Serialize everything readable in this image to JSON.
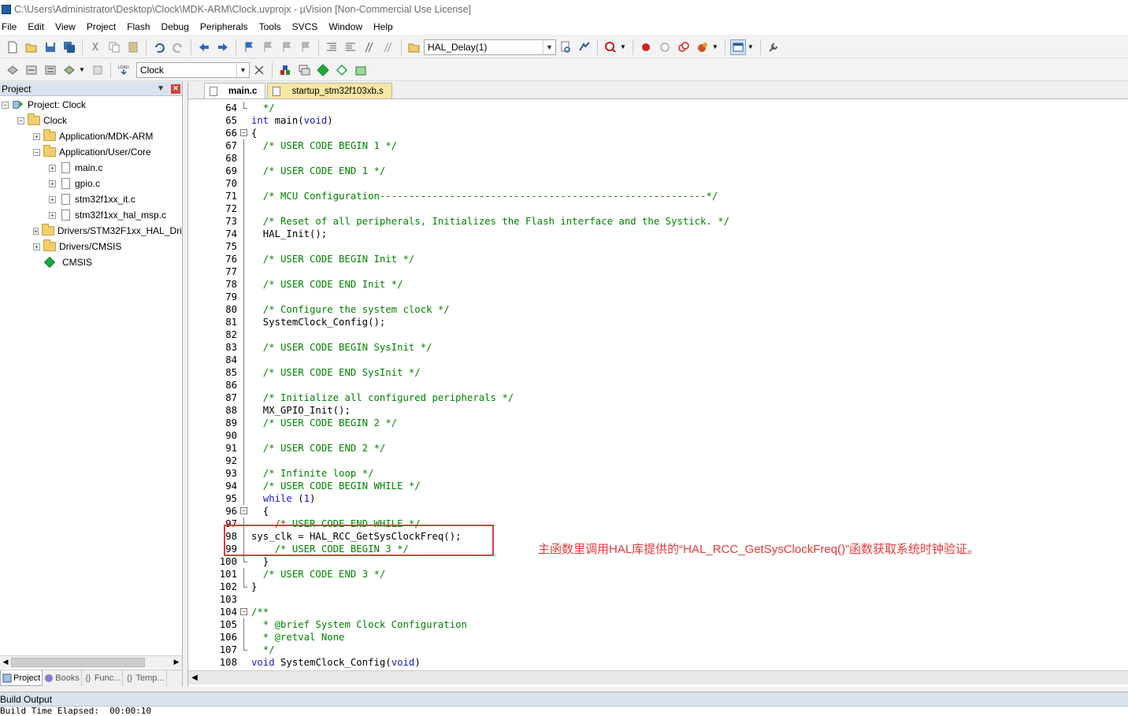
{
  "window": {
    "title": "C:\\Users\\Administrator\\Desktop\\Clock\\MDK-ARM\\Clock.uvprojx - µVision  [Non-Commercial Use License]"
  },
  "menu": [
    "File",
    "Edit",
    "View",
    "Project",
    "Flash",
    "Debug",
    "Peripherals",
    "Tools",
    "SVCS",
    "Window",
    "Help"
  ],
  "toolbar1": {
    "find_combo": "HAL_Delay(1)"
  },
  "toolbar2": {
    "target_combo": "Clock"
  },
  "project_panel": {
    "title": "Project",
    "tree": [
      {
        "label": "Project: Clock",
        "icon": "project-icon",
        "expander": "−"
      },
      {
        "label": "Clock",
        "icon": "folder-icon",
        "expander": "−"
      },
      {
        "label": "Application/MDK-ARM",
        "icon": "folder-icon",
        "expander": "+"
      },
      {
        "label": "Application/User/Core",
        "icon": "folder-icon",
        "expander": "−"
      },
      {
        "label": "main.c",
        "icon": "file-icon",
        "expander": "+"
      },
      {
        "label": "gpio.c",
        "icon": "file-icon",
        "expander": "+"
      },
      {
        "label": "stm32f1xx_it.c",
        "icon": "file-icon",
        "expander": "+"
      },
      {
        "label": "stm32f1xx_hal_msp.c",
        "icon": "file-icon",
        "expander": "+"
      },
      {
        "label": "Drivers/STM32F1xx_HAL_Driver",
        "icon": "folder-icon",
        "expander": "+"
      },
      {
        "label": "Drivers/CMSIS",
        "icon": "folder-icon",
        "expander": "+"
      },
      {
        "label": "CMSIS",
        "icon": "diamond-icon",
        "expander": ""
      }
    ],
    "tabs": [
      "Project",
      "Books",
      "Func...",
      "Temp..."
    ]
  },
  "editor": {
    "tabs": [
      "main.c",
      "startup_stm32f103xb.s"
    ],
    "lines": [
      {
        "n": "64",
        "fold": "end",
        "segs": [
          {
            "t": "  */",
            "c": "cmt"
          }
        ]
      },
      {
        "n": "65",
        "fold": "",
        "segs": [
          {
            "t": "int",
            "c": "kw"
          },
          {
            "t": " main(",
            "c": ""
          },
          {
            "t": "void",
            "c": "kw"
          },
          {
            "t": ")",
            "c": ""
          }
        ]
      },
      {
        "n": "66",
        "fold": "open",
        "segs": [
          {
            "t": "{",
            "c": ""
          }
        ]
      },
      {
        "n": "67",
        "fold": "line",
        "segs": [
          {
            "t": "  /* USER CODE BEGIN 1 */",
            "c": "cmt"
          }
        ]
      },
      {
        "n": "68",
        "fold": "line",
        "segs": []
      },
      {
        "n": "69",
        "fold": "line",
        "segs": [
          {
            "t": "  /* USER CODE END 1 */",
            "c": "cmt"
          }
        ]
      },
      {
        "n": "70",
        "fold": "line",
        "segs": []
      },
      {
        "n": "71",
        "fold": "line",
        "segs": [
          {
            "t": "  /* MCU Configuration--------------------------------------------------------*/",
            "c": "cmt"
          }
        ]
      },
      {
        "n": "72",
        "fold": "line",
        "segs": []
      },
      {
        "n": "73",
        "fold": "line",
        "segs": [
          {
            "t": "  /* Reset of all peripherals, Initializes the Flash interface and the Systick. */",
            "c": "cmt"
          }
        ]
      },
      {
        "n": "74",
        "fold": "line",
        "segs": [
          {
            "t": "  HAL_Init();",
            "c": ""
          }
        ]
      },
      {
        "n": "75",
        "fold": "line",
        "segs": []
      },
      {
        "n": "76",
        "fold": "line",
        "segs": [
          {
            "t": "  /* USER CODE BEGIN Init */",
            "c": "cmt"
          }
        ]
      },
      {
        "n": "77",
        "fold": "line",
        "segs": []
      },
      {
        "n": "78",
        "fold": "line",
        "segs": [
          {
            "t": "  /* USER CODE END Init */",
            "c": "cmt"
          }
        ]
      },
      {
        "n": "79",
        "fold": "line",
        "segs": []
      },
      {
        "n": "80",
        "fold": "line",
        "segs": [
          {
            "t": "  /* Configure the system clock */",
            "c": "cmt"
          }
        ]
      },
      {
        "n": "81",
        "fold": "line",
        "segs": [
          {
            "t": "  SystemClock_Config();",
            "c": ""
          }
        ]
      },
      {
        "n": "82",
        "fold": "line",
        "segs": []
      },
      {
        "n": "83",
        "fold": "line",
        "segs": [
          {
            "t": "  /* USER CODE BEGIN SysInit */",
            "c": "cmt"
          }
        ]
      },
      {
        "n": "84",
        "fold": "line",
        "segs": []
      },
      {
        "n": "85",
        "fold": "line",
        "segs": [
          {
            "t": "  /* USER CODE END SysInit */",
            "c": "cmt"
          }
        ]
      },
      {
        "n": "86",
        "fold": "line",
        "segs": []
      },
      {
        "n": "87",
        "fold": "line",
        "segs": [
          {
            "t": "  /* Initialize all configured peripherals */",
            "c": "cmt"
          }
        ]
      },
      {
        "n": "88",
        "fold": "line",
        "segs": [
          {
            "t": "  MX_GPIO_Init();",
            "c": ""
          }
        ]
      },
      {
        "n": "89",
        "fold": "line",
        "segs": [
          {
            "t": "  /* USER CODE BEGIN 2 */",
            "c": "cmt"
          }
        ]
      },
      {
        "n": "90",
        "fold": "line",
        "segs": []
      },
      {
        "n": "91",
        "fold": "line",
        "segs": [
          {
            "t": "  /* USER CODE END 2 */",
            "c": "cmt"
          }
        ]
      },
      {
        "n": "92",
        "fold": "line",
        "segs": []
      },
      {
        "n": "93",
        "fold": "line",
        "segs": [
          {
            "t": "  /* Infinite loop */",
            "c": "cmt"
          }
        ]
      },
      {
        "n": "94",
        "fold": "line",
        "segs": [
          {
            "t": "  /* USER CODE BEGIN WHILE */",
            "c": "cmt"
          }
        ]
      },
      {
        "n": "95",
        "fold": "line",
        "segs": [
          {
            "t": "  ",
            "c": ""
          },
          {
            "t": "while",
            "c": "kw"
          },
          {
            "t": " (",
            "c": ""
          },
          {
            "t": "1",
            "c": "num"
          },
          {
            "t": ")",
            "c": ""
          }
        ]
      },
      {
        "n": "96",
        "fold": "open",
        "segs": [
          {
            "t": "  {",
            "c": ""
          }
        ]
      },
      {
        "n": "97",
        "fold": "line",
        "segs": [
          {
            "t": "    /* USER CODE END WHILE */",
            "c": "cmt"
          }
        ]
      },
      {
        "n": "98",
        "fold": "line",
        "segs": [
          {
            "t": "sys_clk = HAL_RCC_GetSysClockFreq();",
            "c": ""
          }
        ]
      },
      {
        "n": "99",
        "fold": "line",
        "segs": [
          {
            "t": "    /* USER CODE BEGIN 3 */",
            "c": "cmt"
          }
        ]
      },
      {
        "n": "100",
        "fold": "end",
        "segs": [
          {
            "t": "  }",
            "c": ""
          }
        ]
      },
      {
        "n": "101",
        "fold": "line",
        "segs": [
          {
            "t": "  /* USER CODE END 3 */",
            "c": "cmt"
          }
        ]
      },
      {
        "n": "102",
        "fold": "end",
        "segs": [
          {
            "t": "}",
            "c": ""
          }
        ]
      },
      {
        "n": "103",
        "fold": "",
        "segs": []
      },
      {
        "n": "104",
        "fold": "open",
        "segs": [
          {
            "t": "/**",
            "c": "cmt"
          }
        ]
      },
      {
        "n": "105",
        "fold": "line",
        "segs": [
          {
            "t": "  * @brief System Clock Configuration",
            "c": "cmt"
          }
        ]
      },
      {
        "n": "106",
        "fold": "line",
        "segs": [
          {
            "t": "  * @retval None",
            "c": "cmt"
          }
        ]
      },
      {
        "n": "107",
        "fold": "end",
        "segs": [
          {
            "t": "  */",
            "c": "cmt"
          }
        ]
      },
      {
        "n": "108",
        "fold": "",
        "segs": [
          {
            "t": "void",
            "c": "kw"
          },
          {
            "t": " SystemClock_Config(",
            "c": ""
          },
          {
            "t": "void",
            "c": "kw"
          },
          {
            "t": ")",
            "c": ""
          }
        ]
      }
    ],
    "annotation": "主函数里调用HAL库提供的“HAL_RCC_GetSysClockFreq()”函数获取系统时钟验证。"
  },
  "build_output": {
    "title": "Build Output",
    "line": "Build Time Elapsed:  00:00:10"
  },
  "colors": {
    "comment": "#008200",
    "keyword": "#1a1acc",
    "annotation": "#e83a3a"
  }
}
